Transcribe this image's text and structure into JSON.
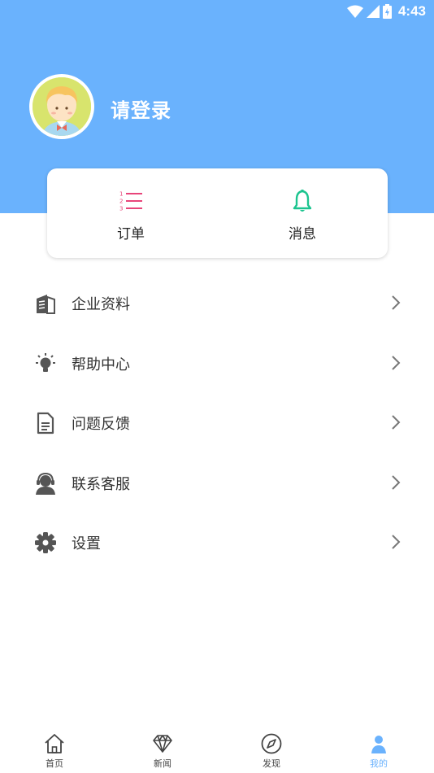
{
  "status_bar": {
    "time": "4:43",
    "wifi_icon": "wifi-icon",
    "signal_icon": "signal-icon",
    "battery_icon": "battery-icon"
  },
  "profile": {
    "login_text": "请登录",
    "avatar_icon": "user-avatar-icon"
  },
  "quick_actions": [
    {
      "label": "订单",
      "icon": "numbered-list-icon",
      "color": "#e8457a"
    },
    {
      "label": "消息",
      "icon": "bell-icon",
      "color": "#1cc48f"
    }
  ],
  "menu": [
    {
      "label": "企业资料",
      "icon": "building-icon"
    },
    {
      "label": "帮助中心",
      "icon": "lightbulb-icon"
    },
    {
      "label": "问题反馈",
      "icon": "document-icon"
    },
    {
      "label": "联系客服",
      "icon": "headset-icon"
    },
    {
      "label": "设置",
      "icon": "gear-icon"
    }
  ],
  "tabs": [
    {
      "label": "首页",
      "icon": "home-icon"
    },
    {
      "label": "新闻",
      "icon": "diamond-icon"
    },
    {
      "label": "发现",
      "icon": "compass-icon"
    },
    {
      "label": "我的",
      "icon": "person-icon",
      "active": true
    }
  ],
  "colors": {
    "header": "#6ab2fd",
    "accent": "#6ab2fd",
    "orders_icon": "#e8457a",
    "messages_icon": "#1cc48f",
    "menu_icon": "#555555"
  }
}
